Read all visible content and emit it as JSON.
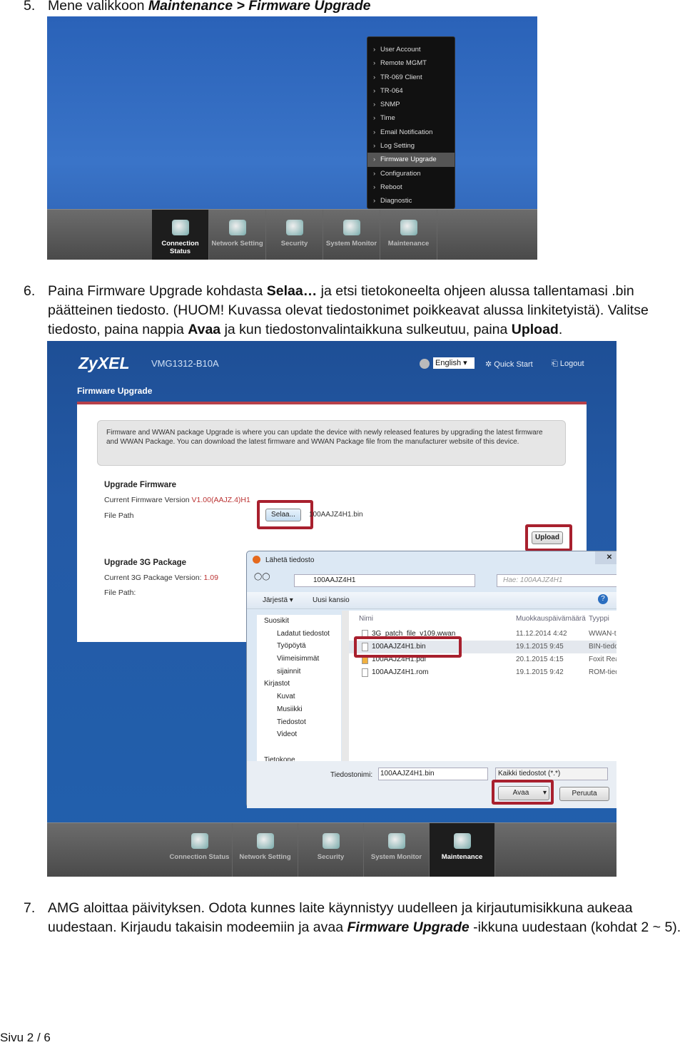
{
  "step5": {
    "num": "5.",
    "text_before": "Mene valikkoon ",
    "emph": "Maintenance > Firmware Upgrade"
  },
  "screenshot1": {
    "menu_items": [
      "User Account",
      "Remote MGMT",
      "TR-069 Client",
      "TR-064",
      "SNMP",
      "Time",
      "Email Notification",
      "Log Setting",
      "Firmware Upgrade",
      "Configuration",
      "Reboot",
      "Diagnostic"
    ],
    "selected_menu": "Firmware Upgrade",
    "tabs": [
      "Connection Status",
      "Network Setting",
      "Security",
      "System Monitor",
      "Maintenance"
    ],
    "selected_tab": "Connection Status"
  },
  "step6": {
    "num": "6.",
    "t1": "Paina Firmware Upgrade kohdasta ",
    "b1": "Selaa…",
    "t2": " ja etsi tietokoneelta ohjeen alussa tallentamasi .bin päätteinen tiedosto. (HUOM! Kuvassa olevat tiedostonimet poikkeavat alussa linkitetyistä). Valitse tiedosto, paina nappia ",
    "b2": "Avaa",
    "t3": " ja kun tiedostonvalintaikkuna sulkeutuu, paina ",
    "b3": "Upload",
    "t4": "."
  },
  "screenshot2": {
    "logo": "ZyXEL",
    "model": "VMG1312-B10A",
    "language": "English",
    "quick_start": "Quick Start",
    "logout": "Logout",
    "page_title": "Firmware Upgrade",
    "info": "Firmware and WWAN package Upgrade is where you can update the device with newly released features by upgrading the latest firmware and WWAN Package. You can download the latest firmware and WWAN Package file from the manufacturer website of this device.",
    "fw_heading": "Upgrade Firmware",
    "fw_version_label": "Current Firmware Version",
    "fw_version": "V1.00(AAJZ.4)H1",
    "file_path_label": "File Path",
    "browse": "Selaa...",
    "file_value": "100AAJZ4H1.bin",
    "upload": "Upload",
    "pkg_heading": "Upgrade 3G Package",
    "pkg_version_label": "Current 3G Package Version:",
    "pkg_version": "1.09",
    "pkg_file_path_label": "File Path:",
    "dialog": {
      "title": "Lähetä tiedosto",
      "path": "100AAJZ4H1",
      "search_placeholder": "Hae: 100AAJZ4H1",
      "organize": "Järjestä",
      "new_folder": "Uusi kansio",
      "sidebar": [
        "Suosikit",
        "Ladatut tiedostot",
        "Työpöytä",
        "Viimeisimmät sijainnit",
        "",
        "Kirjastot",
        "Kuvat",
        "Musiikki",
        "Tiedostot",
        "Videot",
        "",
        "Tietokone"
      ],
      "columns": [
        "Nimi",
        "Muokkauspäivämäärä",
        "Tyyppi"
      ],
      "files": [
        {
          "name": "3G_patch_file_v109.wwan",
          "date": "11.12.2014 4:42",
          "type": "WWAN-tiedosto"
        },
        {
          "name": "100AAJZ4H1.bin",
          "date": "19.1.2015 9:45",
          "type": "BIN-tiedosto"
        },
        {
          "name": "100AAJZ4H1.pdf",
          "date": "20.1.2015 4:15",
          "type": "Foxit Reader"
        },
        {
          "name": "100AAJZ4H1.rom",
          "date": "19.1.2015 9:42",
          "type": "ROM-tiedosto"
        }
      ],
      "filename_label": "Tiedostonimi:",
      "filename_value": "100AAJZ4H1.bin",
      "filter": "Kaikki tiedostot (*.*)",
      "open": "Avaa",
      "cancel": "Peruuta"
    },
    "tabs": [
      "Connection Status",
      "Network Setting",
      "Security",
      "System Monitor",
      "Maintenance"
    ],
    "selected_tab": "Maintenance"
  },
  "step7": {
    "num": "7.",
    "t1": "AMG aloittaa päivityksen. Odota kunnes laite käynnistyy uudelleen ja kirjautumisikkuna aukeaa uudestaan. Kirjaudu takaisin modeemiin ja avaa ",
    "emph": "Firmware Upgrade",
    "t2": " -ikkuna uudestaan (kohdat 2 ~ 5)."
  },
  "footer": "Sivu 2 / 6",
  "colors": {
    "highlight": "#a8202e",
    "zyxel_blue": "#1e4f96",
    "accent_red": "#b6404a"
  }
}
